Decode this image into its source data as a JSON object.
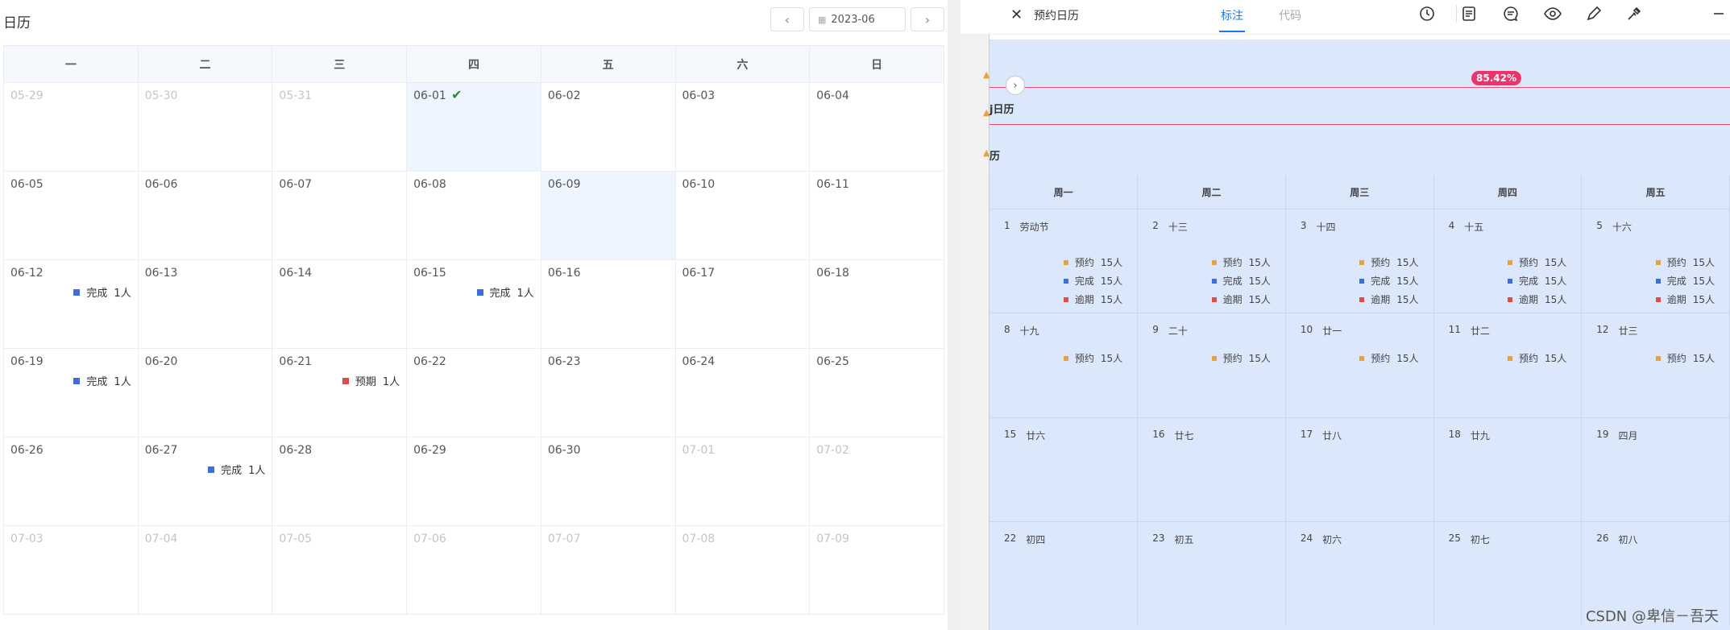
{
  "left": {
    "title": "日历",
    "prev_icon": "chevron-left-icon",
    "next_icon": "chevron-right-icon",
    "date_value": "2023-06",
    "weekdays": [
      "一",
      "二",
      "三",
      "四",
      "五",
      "六",
      "日"
    ],
    "weeks": [
      [
        {
          "d": "05-29",
          "dim": true
        },
        {
          "d": "05-30",
          "dim": true
        },
        {
          "d": "05-31",
          "dim": true
        },
        {
          "d": "06-01",
          "hl": true,
          "check": true
        },
        {
          "d": "06-02"
        },
        {
          "d": "06-03"
        },
        {
          "d": "06-04"
        }
      ],
      [
        {
          "d": "06-05"
        },
        {
          "d": "06-06"
        },
        {
          "d": "06-07"
        },
        {
          "d": "06-08"
        },
        {
          "d": "06-09",
          "hl": true
        },
        {
          "d": "06-10"
        },
        {
          "d": "06-11"
        }
      ],
      [
        {
          "d": "06-12",
          "ev": {
            "label": "完成",
            "count": "1人",
            "color": "#3b6fe0"
          }
        },
        {
          "d": "06-13"
        },
        {
          "d": "06-14"
        },
        {
          "d": "06-15",
          "ev": {
            "label": "完成",
            "count": "1人",
            "color": "#3b6fe0"
          }
        },
        {
          "d": "06-16"
        },
        {
          "d": "06-17"
        },
        {
          "d": "06-18"
        }
      ],
      [
        {
          "d": "06-19",
          "ev": {
            "label": "完成",
            "count": "1人",
            "color": "#3b6fe0"
          }
        },
        {
          "d": "06-20"
        },
        {
          "d": "06-21",
          "ev": {
            "label": "预期",
            "count": "1人",
            "color": "#e84848"
          }
        },
        {
          "d": "06-22"
        },
        {
          "d": "06-23"
        },
        {
          "d": "06-24"
        },
        {
          "d": "06-25"
        }
      ],
      [
        {
          "d": "06-26"
        },
        {
          "d": "06-27",
          "ev": {
            "label": "完成",
            "count": "1人",
            "color": "#3b6fe0"
          }
        },
        {
          "d": "06-28"
        },
        {
          "d": "06-29"
        },
        {
          "d": "06-30"
        },
        {
          "d": "07-01",
          "dim": true
        },
        {
          "d": "07-02",
          "dim": true
        }
      ],
      [
        {
          "d": "07-03",
          "dim": true
        },
        {
          "d": "07-04",
          "dim": true
        },
        {
          "d": "07-05",
          "dim": true
        },
        {
          "d": "07-06",
          "dim": true
        },
        {
          "d": "07-07",
          "dim": true
        },
        {
          "d": "07-08",
          "dim": true
        },
        {
          "d": "07-09",
          "dim": true
        }
      ]
    ]
  },
  "right": {
    "close_icon": "close-icon",
    "title": "预约日历",
    "tabs": [
      {
        "label": "标注",
        "active": true
      },
      {
        "label": "代码",
        "active": false
      }
    ],
    "toolbar_icons": [
      "clock-icon",
      "document-icon",
      "comment-icon",
      "eye-icon",
      "pen-icon",
      "eyedropper-icon",
      "minus-icon"
    ],
    "percent": "85.42%",
    "label_1": "j日历",
    "label_2": "历",
    "weekdays": [
      "周一",
      "周二",
      "周三",
      "周四",
      "周五"
    ],
    "legend": [
      {
        "label": "预约",
        "count": "15人",
        "color": "#e6a23c"
      },
      {
        "label": "完成",
        "count": "15人",
        "color": "#3b6fe0"
      },
      {
        "label": "逾期",
        "count": "15人",
        "color": "#e84848"
      }
    ],
    "rows": [
      [
        {
          "n": "1",
          "lunar": "劳动节",
          "evs": 3
        },
        {
          "n": "2",
          "lunar": "十三",
          "evs": 3
        },
        {
          "n": "3",
          "lunar": "十四",
          "evs": 3
        },
        {
          "n": "4",
          "lunar": "十五",
          "evs": 3
        },
        {
          "n": "5",
          "lunar": "十六",
          "evs": 3
        }
      ],
      [
        {
          "n": "8",
          "lunar": "十九",
          "evs": 1
        },
        {
          "n": "9",
          "lunar": "二十",
          "evs": 1
        },
        {
          "n": "10",
          "lunar": "廿一",
          "evs": 1
        },
        {
          "n": "11",
          "lunar": "廿二",
          "evs": 1
        },
        {
          "n": "12",
          "lunar": "廿三",
          "evs": 1
        }
      ],
      [
        {
          "n": "15",
          "lunar": "廿六",
          "evs": 0
        },
        {
          "n": "16",
          "lunar": "廿七",
          "evs": 0
        },
        {
          "n": "17",
          "lunar": "廿八",
          "evs": 0
        },
        {
          "n": "18",
          "lunar": "廿九",
          "evs": 0
        },
        {
          "n": "19",
          "lunar": "四月",
          "evs": 0
        }
      ],
      [
        {
          "n": "22",
          "lunar": "初四",
          "evs": 0
        },
        {
          "n": "23",
          "lunar": "初五",
          "evs": 0
        },
        {
          "n": "24",
          "lunar": "初六",
          "evs": 0
        },
        {
          "n": "25",
          "lunar": "初七",
          "evs": 0
        },
        {
          "n": "26",
          "lunar": "初八",
          "evs": 0
        }
      ]
    ]
  },
  "watermark": "CSDN @卑信－吾天"
}
